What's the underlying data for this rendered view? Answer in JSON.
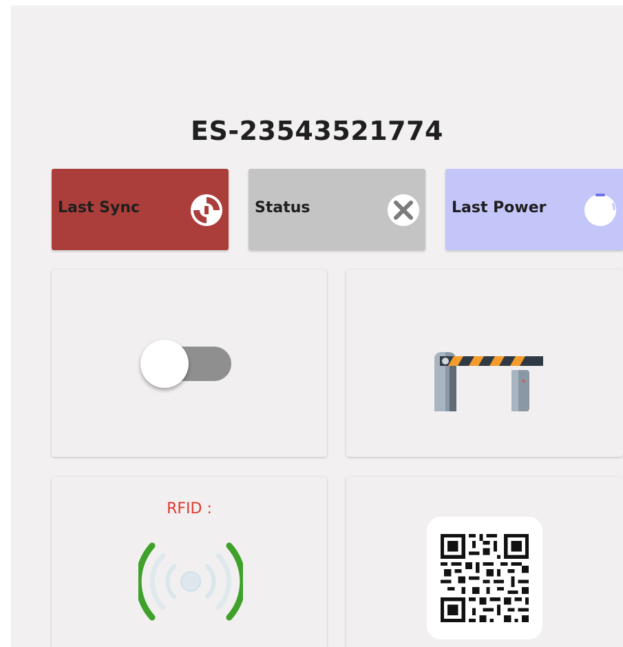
{
  "device": {
    "id": "ES-23543521774"
  },
  "status_cards": {
    "last_sync": {
      "label": "Last Sync",
      "color": "#ab3e3a",
      "icon": "sync-icon"
    },
    "status": {
      "label": "Status",
      "color": "#c4c4c4",
      "icon": "close-circle-icon"
    },
    "last_power": {
      "label": "Last Power",
      "color": "#c4c6fa",
      "icon": "power-icon"
    }
  },
  "tiles": {
    "toggle": {
      "icon": "toggle-switch-icon",
      "state": "off"
    },
    "barrier": {
      "icon": "barrier-gate-icon"
    },
    "rfid": {
      "label": "RFID :",
      "icon": "rfid-signal-icon",
      "label_color": "#e0372c"
    },
    "qr": {
      "icon": "qr-code-icon"
    }
  }
}
